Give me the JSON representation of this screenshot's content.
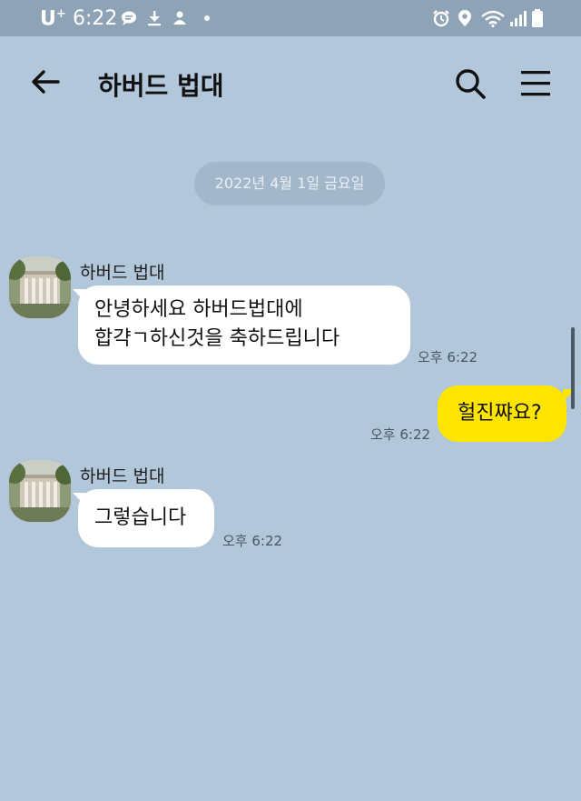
{
  "status_bar": {
    "carrier": "U",
    "carrier_sup": "+",
    "time": "6:22"
  },
  "header": {
    "title": "하버드 법대"
  },
  "date_divider": "2022년 4월 1일 금요일",
  "messages": [
    {
      "sender": "하버드 법대",
      "lines": [
        "안녕하세요 하버드법대에",
        "합갹ㄱ하신것을 축하드립니다"
      ],
      "time": "오후 6:22"
    },
    {
      "sender": "me",
      "text": "헐진쨔요?",
      "time": "오후 6:22"
    },
    {
      "sender": "하버드 법대",
      "text": "그렇습니다",
      "time": "오후 6:22"
    }
  ],
  "colors": {
    "background": "#b2c7da",
    "my_bubble": "#fee500",
    "other_bubble": "#ffffff"
  },
  "icons": [
    "arrow-left-icon",
    "search-icon",
    "hamburger-menu-icon",
    "avatar-building-image"
  ]
}
